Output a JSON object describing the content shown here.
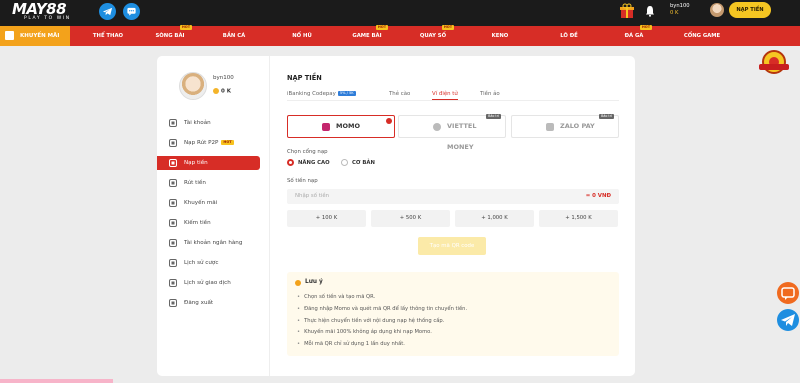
{
  "brand": {
    "logo_text": "MAY88",
    "logo_tagline": "PLAY TO WIN"
  },
  "header": {
    "username": "byn100",
    "balance": "0 K",
    "deposit_button": "NẠP TIỀN"
  },
  "nav": {
    "promo_label": "KHUYẾN MÃI",
    "items": [
      {
        "label": "THỂ THAO",
        "hot": ""
      },
      {
        "label": "SÒNG BÀI",
        "hot": "HOT"
      },
      {
        "label": "BẮN CÁ",
        "hot": ""
      },
      {
        "label": "NỔ HŨ",
        "hot": ""
      },
      {
        "label": "GAME BÀI",
        "hot": "HOT"
      },
      {
        "label": "QUAY SỐ",
        "hot": "HOT"
      },
      {
        "label": "KENO",
        "hot": ""
      },
      {
        "label": "LÔ ĐỀ",
        "hot": ""
      },
      {
        "label": "ĐÁ GÀ",
        "hot": "HOT"
      },
      {
        "label": "CỔNG GAME",
        "hot": ""
      }
    ]
  },
  "sidebar": {
    "username": "byn100",
    "balance": "0 K",
    "items": [
      {
        "label": "Tài khoản",
        "badge": ""
      },
      {
        "label": "Nạp Rút P2P",
        "badge": "HOT"
      },
      {
        "label": "Nạp tiền",
        "badge": ""
      },
      {
        "label": "Rút tiền",
        "badge": ""
      },
      {
        "label": "Khuyến mãi",
        "badge": ""
      },
      {
        "label": "Kiếm tiền",
        "badge": ""
      },
      {
        "label": "Tài khoản ngân hàng",
        "badge": ""
      },
      {
        "label": "Lịch sử cược",
        "badge": ""
      },
      {
        "label": "Lịch sử giao dịch",
        "badge": ""
      },
      {
        "label": "Đăng xuất",
        "badge": ""
      }
    ],
    "active_index": 2
  },
  "main": {
    "title": "NẠP TIỀN",
    "tabs": [
      {
        "label": "iBanking Codepay",
        "tag": "5% / 5K"
      },
      {
        "label": "Thẻ cào",
        "tag": ""
      },
      {
        "label": "Ví điện tử",
        "tag": ""
      },
      {
        "label": "Tiền ảo",
        "tag": ""
      }
    ],
    "active_tab": 2,
    "methods": [
      {
        "label": "MOMO",
        "status": ""
      },
      {
        "label": "VIETTEL MONEY",
        "status": "Bảo trì"
      },
      {
        "label": "ZALO PAY",
        "status": "Bảo trì"
      }
    ],
    "gateway_label": "Chọn cổng nạp",
    "gateways": [
      "NÂNG CAO",
      "CƠ BẢN"
    ],
    "amount_label": "Số tiền nạp",
    "amount_placeholder": "Nhập số tiền",
    "amount_equiv": "= 0 VNĐ",
    "quick_amounts": [
      "+ 100 K",
      "+ 500 K",
      "+ 1,000 K",
      "+ 1,500 K"
    ],
    "submit_label": "Tạo mã QR code",
    "note": {
      "title": "Lưu ý",
      "items": [
        "Chọn số tiền và tạo mã QR.",
        "Đăng nhập Momo và quét mã QR để lấy thông tin chuyển tiền.",
        "Thực hiện chuyển tiền với nội dung nạp hệ thống cấp.",
        "Khuyến mãi 100% không áp dụng khi nạp Momo.",
        "Mỗi mã QR chỉ sử dụng 1 lần duy nhất."
      ]
    }
  },
  "colors": {
    "accent": "#d72d26",
    "gold": "#f6c622",
    "promo": "#f3a21b",
    "momo": "#c4266d",
    "telegram": "#1e8ee0"
  }
}
